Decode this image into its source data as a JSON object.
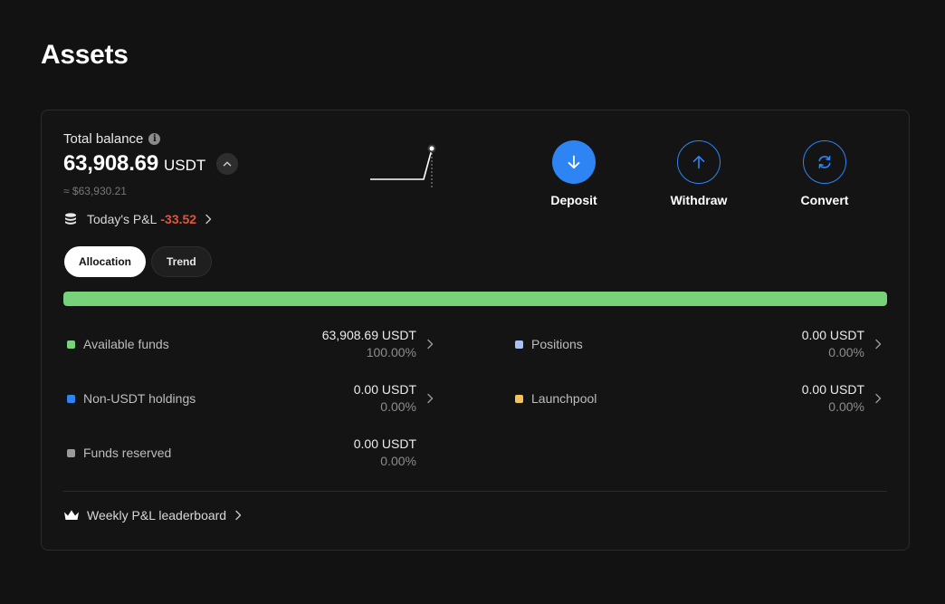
{
  "page": {
    "title": "Assets"
  },
  "balance": {
    "label": "Total balance",
    "amount": "63,908.69",
    "unit": "USDT",
    "approx": "≈ $63,930.21",
    "pnl_label": "Today's P&L",
    "pnl_value": "-33.52"
  },
  "actions": [
    {
      "label": "Deposit",
      "icon": "arrow-down-icon"
    },
    {
      "label": "Withdraw",
      "icon": "arrow-up-icon"
    },
    {
      "label": "Convert",
      "icon": "refresh-icon"
    }
  ],
  "tabs": [
    {
      "label": "Allocation",
      "active": true
    },
    {
      "label": "Trend",
      "active": false
    }
  ],
  "allocation_bar": {
    "fill_fraction": 1.0,
    "color": "#78d27a"
  },
  "allocations": [
    {
      "name": "Available funds",
      "amount": "63,908.69 USDT",
      "percent": "100.00%",
      "color": "#78d27a",
      "has_chevron": true
    },
    {
      "name": "Positions",
      "amount": "0.00 USDT",
      "percent": "0.00%",
      "color": "#a9c0f5",
      "has_chevron": true
    },
    {
      "name": "Non-USDT holdings",
      "amount": "0.00 USDT",
      "percent": "0.00%",
      "color": "#2f84f4",
      "has_chevron": true
    },
    {
      "name": "Launchpool",
      "amount": "0.00 USDT",
      "percent": "0.00%",
      "color": "#f3c35a",
      "has_chevron": true
    },
    {
      "name": "Funds reserved",
      "amount": "0.00 USDT",
      "percent": "0.00%",
      "color": "#9a9a9a",
      "has_chevron": false
    }
  ],
  "leaderboard": {
    "label": "Weekly P&L leaderboard"
  }
}
